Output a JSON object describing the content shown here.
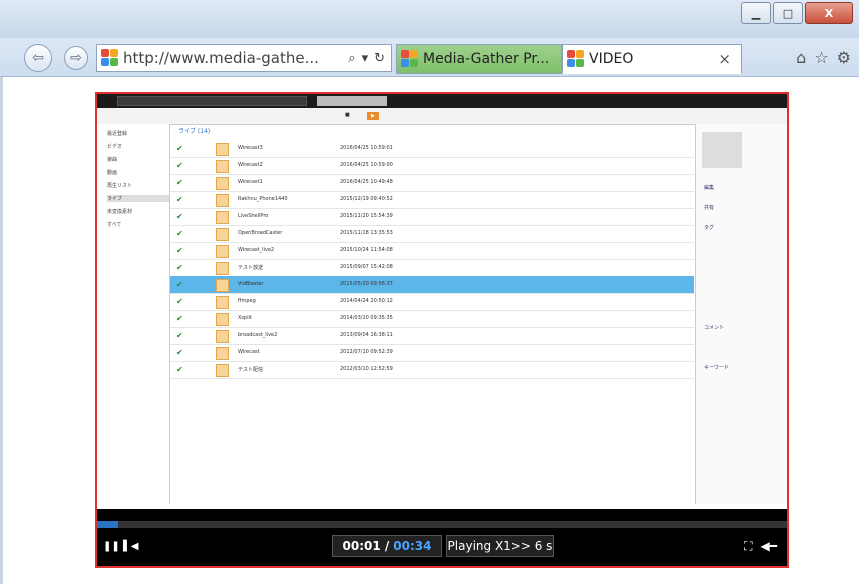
{
  "browser": {
    "url": "http://www.media-gathe...",
    "tabs": [
      {
        "label": "Media-Gather Pr..."
      },
      {
        "label": "VIDEO"
      }
    ],
    "close_glyph": "×",
    "window_buttons": {
      "minimize": "▁",
      "maximize": "□",
      "close": "X"
    },
    "icons": [
      "back-icon",
      "forward-icon",
      "search-icon",
      "refresh-icon",
      "home-icon",
      "star-icon",
      "gear-icon"
    ]
  },
  "capture": {
    "sidebar_items": [
      "最近登録",
      "ビデオ",
      "楽曲",
      "動画",
      "再生リスト",
      "ライブ",
      "未変換素材",
      "すべて"
    ],
    "section_title": "ライブ (14)",
    "rows": [
      {
        "name": "Wirecast3",
        "date": "2016/04/25 10:59:01"
      },
      {
        "name": "Wirecast2",
        "date": "2016/04/25 10:59:00"
      },
      {
        "name": "Wirecast1",
        "date": "2016/04/25 10:49:48"
      },
      {
        "name": "Rakhnu_Phone1440",
        "date": "2015/12/19 09:40:52"
      },
      {
        "name": "LiveShellPro",
        "date": "2015/11/20 15:54:39"
      },
      {
        "name": "OpenBroadCaster",
        "date": "2015/11/18 13:35:53"
      },
      {
        "name": "Wirecast_live2",
        "date": "2015/10/24 11:54:08"
      },
      {
        "name": "テスト放送",
        "date": "2015/09/07 15:42:08"
      },
      {
        "name": "VidBlaster",
        "date": "2015/05/20 09:56:37"
      },
      {
        "name": "ffmpeg",
        "date": "2014/04/24 20:50:12"
      },
      {
        "name": "Xsplit",
        "date": "2014/03/10 09:35:35"
      },
      {
        "name": "broadcast_live2",
        "date": "2013/09/04 16:38:11"
      },
      {
        "name": "Wirecast",
        "date": "2012/07/10 09:52:39"
      },
      {
        "name": "テスト配信",
        "date": "2012/03/10 12:52:59"
      }
    ],
    "selected_row": 8,
    "right_items": [
      "編集",
      "共有",
      "タグ",
      "コメント",
      "キーワード"
    ]
  },
  "player": {
    "progress_fraction": 0.03,
    "current_time": "00:01 /",
    "total_time": "00:34",
    "status": "Playing X1>> 6 s"
  },
  "colors": {
    "accent": "#2a73c4",
    "selection": "#5db6ea",
    "frame": "#e03030"
  }
}
